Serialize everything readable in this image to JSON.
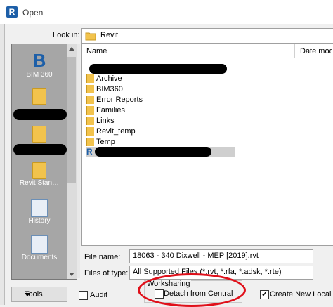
{
  "window": {
    "app_icon_letter": "R",
    "title": "Open"
  },
  "look_in": {
    "label": "Look in:",
    "value": "Revit"
  },
  "places": {
    "items": [
      {
        "label": "BIM 360",
        "icon": "bim360-icon"
      },
      {
        "label": "",
        "icon": "folder-icon"
      },
      {
        "label": "",
        "icon": "folder-icon"
      },
      {
        "label": "Revit Stan…",
        "icon": "folder-icon"
      },
      {
        "label": "History",
        "icon": "history-icon"
      },
      {
        "label": "Documents",
        "icon": "documents-icon"
      }
    ]
  },
  "file_list": {
    "columns": {
      "name": "Name",
      "date": "Date modi"
    },
    "rows": [
      "Archive",
      "BIM360",
      "Error Reports",
      "Families",
      "Links",
      "Revit_temp",
      "Temp"
    ]
  },
  "file_name": {
    "label": "File name:",
    "value": "18063 - 340 Dixwell - MEP [2019].rvt"
  },
  "file_type": {
    "label": "Files of type:",
    "value": "All Supported Files  (*.rvt, *.rfa, *.adsk, *.rte)"
  },
  "tools": {
    "label": "Tools"
  },
  "audit": {
    "label": "Audit",
    "checked": false
  },
  "worksharing": {
    "title": "Worksharing",
    "detach_label": "Detach from Central",
    "detach_checked": false,
    "create_new_local_label": "Create New Local",
    "create_new_local_checked": true
  },
  "colors": {
    "highlight_circle": "#e0101a",
    "revit_blue": "#1d5fa8",
    "folder": "#f2c34d"
  }
}
